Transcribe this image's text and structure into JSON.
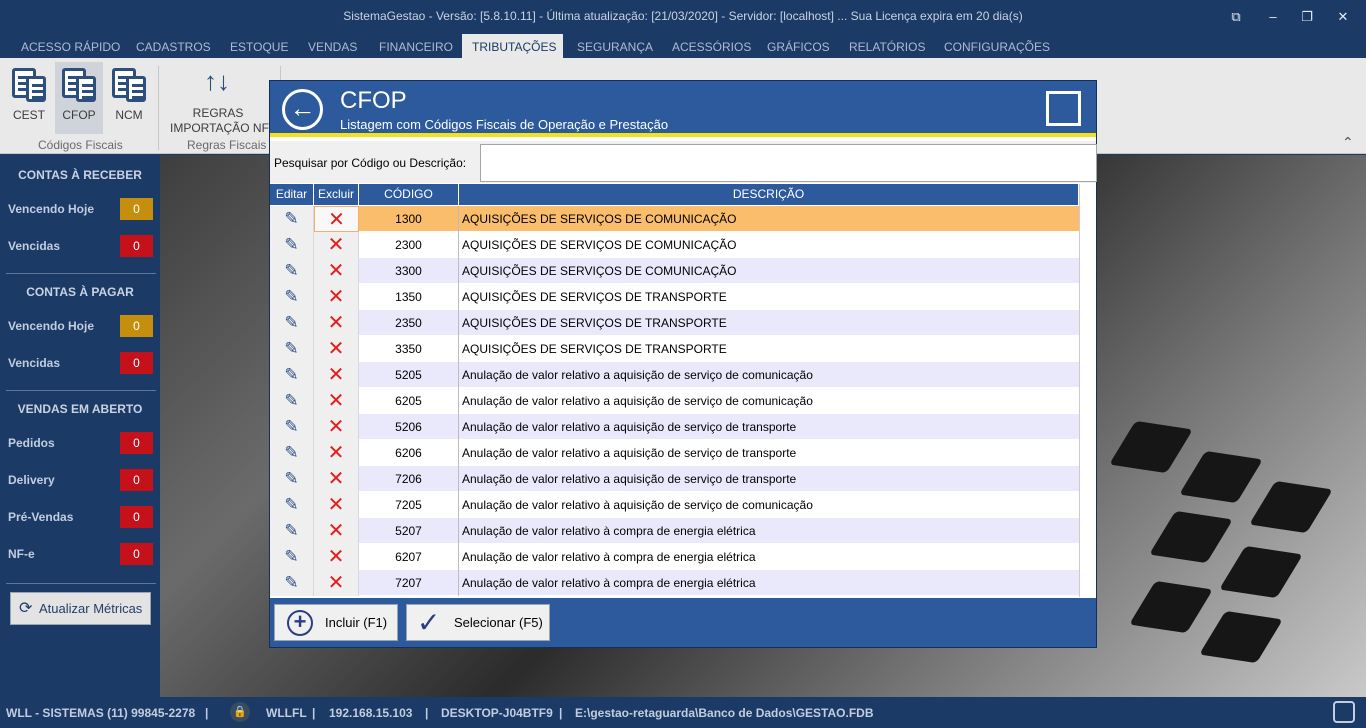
{
  "window": {
    "title": "SistemaGestao - Versão: [5.8.10.11] - Última atualização: [21/03/2020] - Servidor: [localhost] ... Sua Licença expira em 20 dia(s)",
    "buttons": {
      "restore": "⧉",
      "minimize": "–",
      "maximize": "❐",
      "close": "✕"
    }
  },
  "menu": {
    "tabs": [
      "ACESSO RÁPIDO",
      "CADASTROS",
      "ESTOQUE",
      "VENDAS",
      "FINANCEIRO",
      "TRIBUTAÇÕES",
      "SEGURANÇA",
      "ACESSÓRIOS",
      "GRÁFICOS",
      "RELATÓRIOS",
      "CONFIGURAÇÕES"
    ],
    "active": "TRIBUTAÇÕES"
  },
  "ribbon": {
    "cest": "CEST",
    "cfop": "CFOP",
    "ncm": "NCM",
    "group1": "Códigos Fiscais",
    "regras_line1": "REGRAS",
    "regras_line2": "IMPORTAÇÃO NF-",
    "group2": "Regras Fiscais",
    "collapse": "⌃"
  },
  "sidebar": {
    "receber": {
      "title": "CONTAS À RECEBER",
      "vencendo_label": "Vencendo Hoje",
      "vencendo_val": "0",
      "vencidas_label": "Vencidas",
      "vencidas_val": "0"
    },
    "pagar": {
      "title": "CONTAS À PAGAR",
      "vencendo_label": "Vencendo Hoje",
      "vencendo_val": "0",
      "vencidas_label": "Vencidas",
      "vencidas_val": "0"
    },
    "vendas": {
      "title": "VENDAS EM ABERTO",
      "pedidos_label": "Pedidos",
      "pedidos_val": "0",
      "delivery_label": "Delivery",
      "delivery_val": "0",
      "prevendas_label": "Pré-Vendas",
      "prevendas_val": "0",
      "nfe_label": "NF-e",
      "nfe_val": "0"
    },
    "refresh_label": "Atualizar Métricas",
    "colors": {
      "warning": "#c58f0d",
      "danger": "#c4111a"
    }
  },
  "statusbar": {
    "company": "WLL - SISTEMAS (11) 99845-2278",
    "user": "WLLFL",
    "ip": "192.168.15.103",
    "host": "DESKTOP-J04BTF9",
    "db": "E:\\gestao-retaguarda\\Banco de Dados\\GESTAO.FDB",
    "sep": "|"
  },
  "dialog": {
    "title": "CFOP",
    "subtitle": "Listagem com Códigos Fiscais de Operação e Prestação",
    "search_label": "Pesquisar por Código ou Descrição:",
    "search_value": "",
    "columns": {
      "edit": "Editar",
      "del": "Excluir",
      "code": "CÓDIGO",
      "desc": "DESCRIÇÃO"
    },
    "rows": [
      {
        "code": "1300",
        "desc": "AQUISIÇÕES DE SERVIÇOS DE COMUNICAÇÃO"
      },
      {
        "code": "2300",
        "desc": "AQUISIÇÕES DE SERVIÇOS DE COMUNICAÇÃO"
      },
      {
        "code": "3300",
        "desc": "AQUISIÇÕES DE SERVIÇOS DE COMUNICAÇÃO"
      },
      {
        "code": "1350",
        "desc": "AQUISIÇÕES DE SERVIÇOS DE TRANSPORTE"
      },
      {
        "code": "2350",
        "desc": "AQUISIÇÕES DE SERVIÇOS DE TRANSPORTE"
      },
      {
        "code": "3350",
        "desc": "AQUISIÇÕES DE SERVIÇOS DE TRANSPORTE"
      },
      {
        "code": "5205",
        "desc": "Anulação de valor relativo a aquisição de serviço de comunicação"
      },
      {
        "code": "6205",
        "desc": "Anulação de valor relativo a aquisição de serviço de comunicação"
      },
      {
        "code": "5206",
        "desc": "Anulação de valor relativo a aquisição de serviço de transporte"
      },
      {
        "code": "6206",
        "desc": "Anulação de valor relativo a aquisição de serviço de transporte"
      },
      {
        "code": "7206",
        "desc": "Anulação de valor relativo a aquisição de serviço de transporte"
      },
      {
        "code": "7205",
        "desc": "Anulação de valor relativo à aquisição de serviço de comunicação"
      },
      {
        "code": "5207",
        "desc": "Anulação de valor relativo à compra de energia elétrica"
      },
      {
        "code": "6207",
        "desc": "Anulação de valor relativo à compra de energia elétrica"
      },
      {
        "code": "7207",
        "desc": "Anulação de valor relativo à compra de energia elétrica"
      }
    ],
    "selected_row": 0,
    "row_icons": {
      "edit": "pencil-icon",
      "delete": "x-icon"
    },
    "btn_include": "Incluir (F1)",
    "btn_select": "Selecionar (F5)",
    "colors": {
      "header": "#2c5a9d",
      "accent": "#f2e21a",
      "selected": "#f9bd6c",
      "alt": "#e9e9fb",
      "delete": "#e31c1c"
    }
  }
}
